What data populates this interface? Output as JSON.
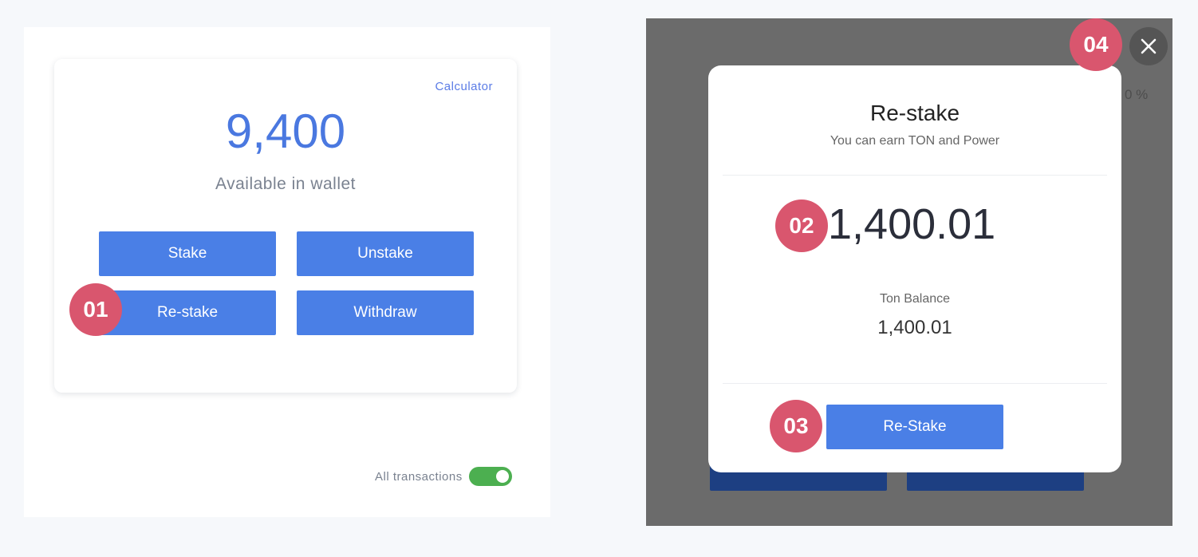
{
  "wallet_panel": {
    "calculator_link": "Calculator",
    "amount": "9,400",
    "caption": "Available in wallet",
    "buttons": {
      "stake": "Stake",
      "unstake": "Unstake",
      "restake": "Re-stake",
      "withdraw": "Withdraw"
    },
    "transactions_toggle": {
      "label": "All transactions",
      "on": true
    }
  },
  "background": {
    "percent_fragment": "0 %"
  },
  "restake_modal": {
    "title": "Re-stake",
    "subtitle": "You can earn TON and Power",
    "amount": "1,400.01",
    "balance_label": "Ton Balance",
    "balance_value": "1,400.01",
    "confirm_button": "Re-Stake"
  },
  "step_markers": [
    "01",
    "02",
    "03",
    "04"
  ],
  "icons": {
    "close": "close-icon"
  },
  "colors": {
    "accent_blue": "#4a7fe6",
    "amount_blue": "#4a78e0",
    "marker_pink": "#d9566e",
    "toggle_green": "#4caf50",
    "overlay_gray": "#6b6b6b"
  }
}
